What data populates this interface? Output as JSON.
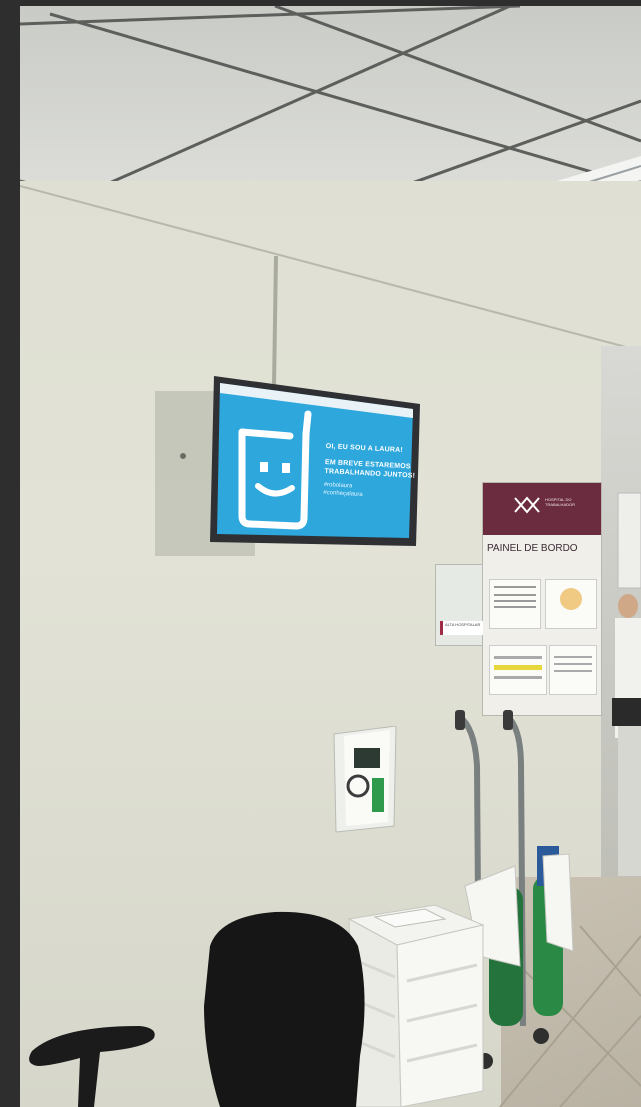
{
  "monitor": {
    "line1": "OI, EU SOU A LAURA!",
    "line2": "EM BREVE ESTAREMOS",
    "line3": "TRABALHANDO JUNTOS!",
    "tag1": "#robolaura",
    "tag2": "#conheçalaura",
    "screen_color": "#2ea7dd"
  },
  "board": {
    "logo_text": "HOSPITAL DO TRABALHADOR",
    "title": "PAINEL DE BORDO",
    "brand_color": "#6a2c3e"
  },
  "sign": {
    "label": "ALTA HOSPITALAR"
  }
}
